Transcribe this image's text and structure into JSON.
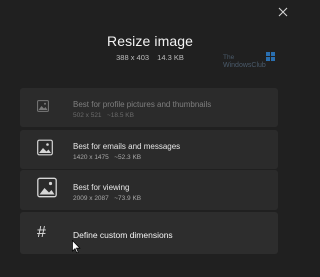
{
  "dialog": {
    "close_icon": "close-icon",
    "title": "Resize image",
    "dimensions": "388 x 403",
    "file_size": "14.3 KB"
  },
  "options": [
    {
      "title": "Best for profile pictures and thumbnails",
      "dimensions": "502 x 521",
      "size": "~18.5 KB",
      "icon": "image-icon",
      "enabled": false
    },
    {
      "title": "Best for emails and messages",
      "dimensions": "1420 x 1475",
      "size": "~52.3 KB",
      "icon": "image-icon",
      "enabled": true
    },
    {
      "title": "Best for viewing",
      "dimensions": "2009 x 2087",
      "size": "~73.9 KB",
      "icon": "image-icon",
      "enabled": true
    },
    {
      "title": "Define custom dimensions",
      "icon": "hash-icon",
      "enabled": true
    }
  ],
  "colors": {
    "background": "#202020",
    "option_bg": "#2b2b2b",
    "text": "#ffffff",
    "muted": "#a8a8a8"
  }
}
